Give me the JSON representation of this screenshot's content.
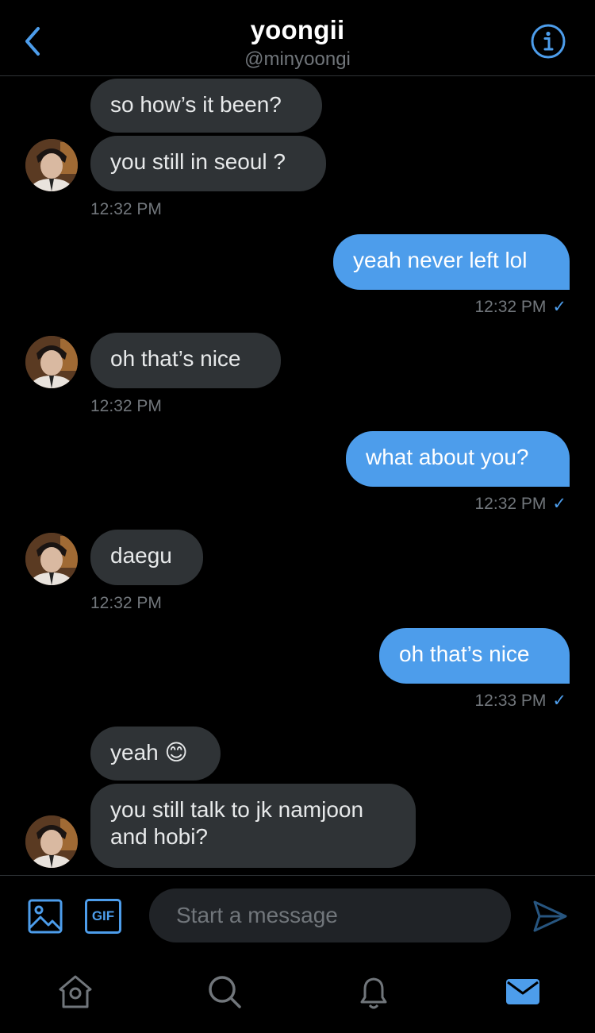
{
  "header": {
    "title": "yoongii",
    "handle": "@minyoongi"
  },
  "messages": [
    {
      "text": "so how’s it been?"
    },
    {
      "text": "you still in seoul ?"
    },
    {
      "time": "12:32 PM"
    },
    {
      "text": "yeah never left lol",
      "time": "12:32 PM"
    },
    {
      "text": "oh that’s nice",
      "time": "12:32 PM"
    },
    {
      "text": "what about you?",
      "time": "12:32 PM"
    },
    {
      "text": "daegu",
      "time": "12:32 PM"
    },
    {
      "text": "oh that’s nice",
      "time": "12:33 PM"
    },
    {
      "text": "yeah 😊"
    },
    {
      "text": "you still talk to jk namjoon and hobi?"
    }
  ],
  "composer": {
    "placeholder": "Start a message",
    "gif_label": "GIF"
  },
  "colors": {
    "accent": "#4d9deb",
    "incoming_bubble": "#2f3336",
    "background": "#000000",
    "muted_text": "#71767b"
  },
  "icons": [
    "back-chevron-icon",
    "info-icon",
    "image-icon",
    "gif-icon",
    "send-icon",
    "home-icon",
    "search-icon",
    "bell-icon",
    "mail-icon",
    "read-check-icon"
  ]
}
